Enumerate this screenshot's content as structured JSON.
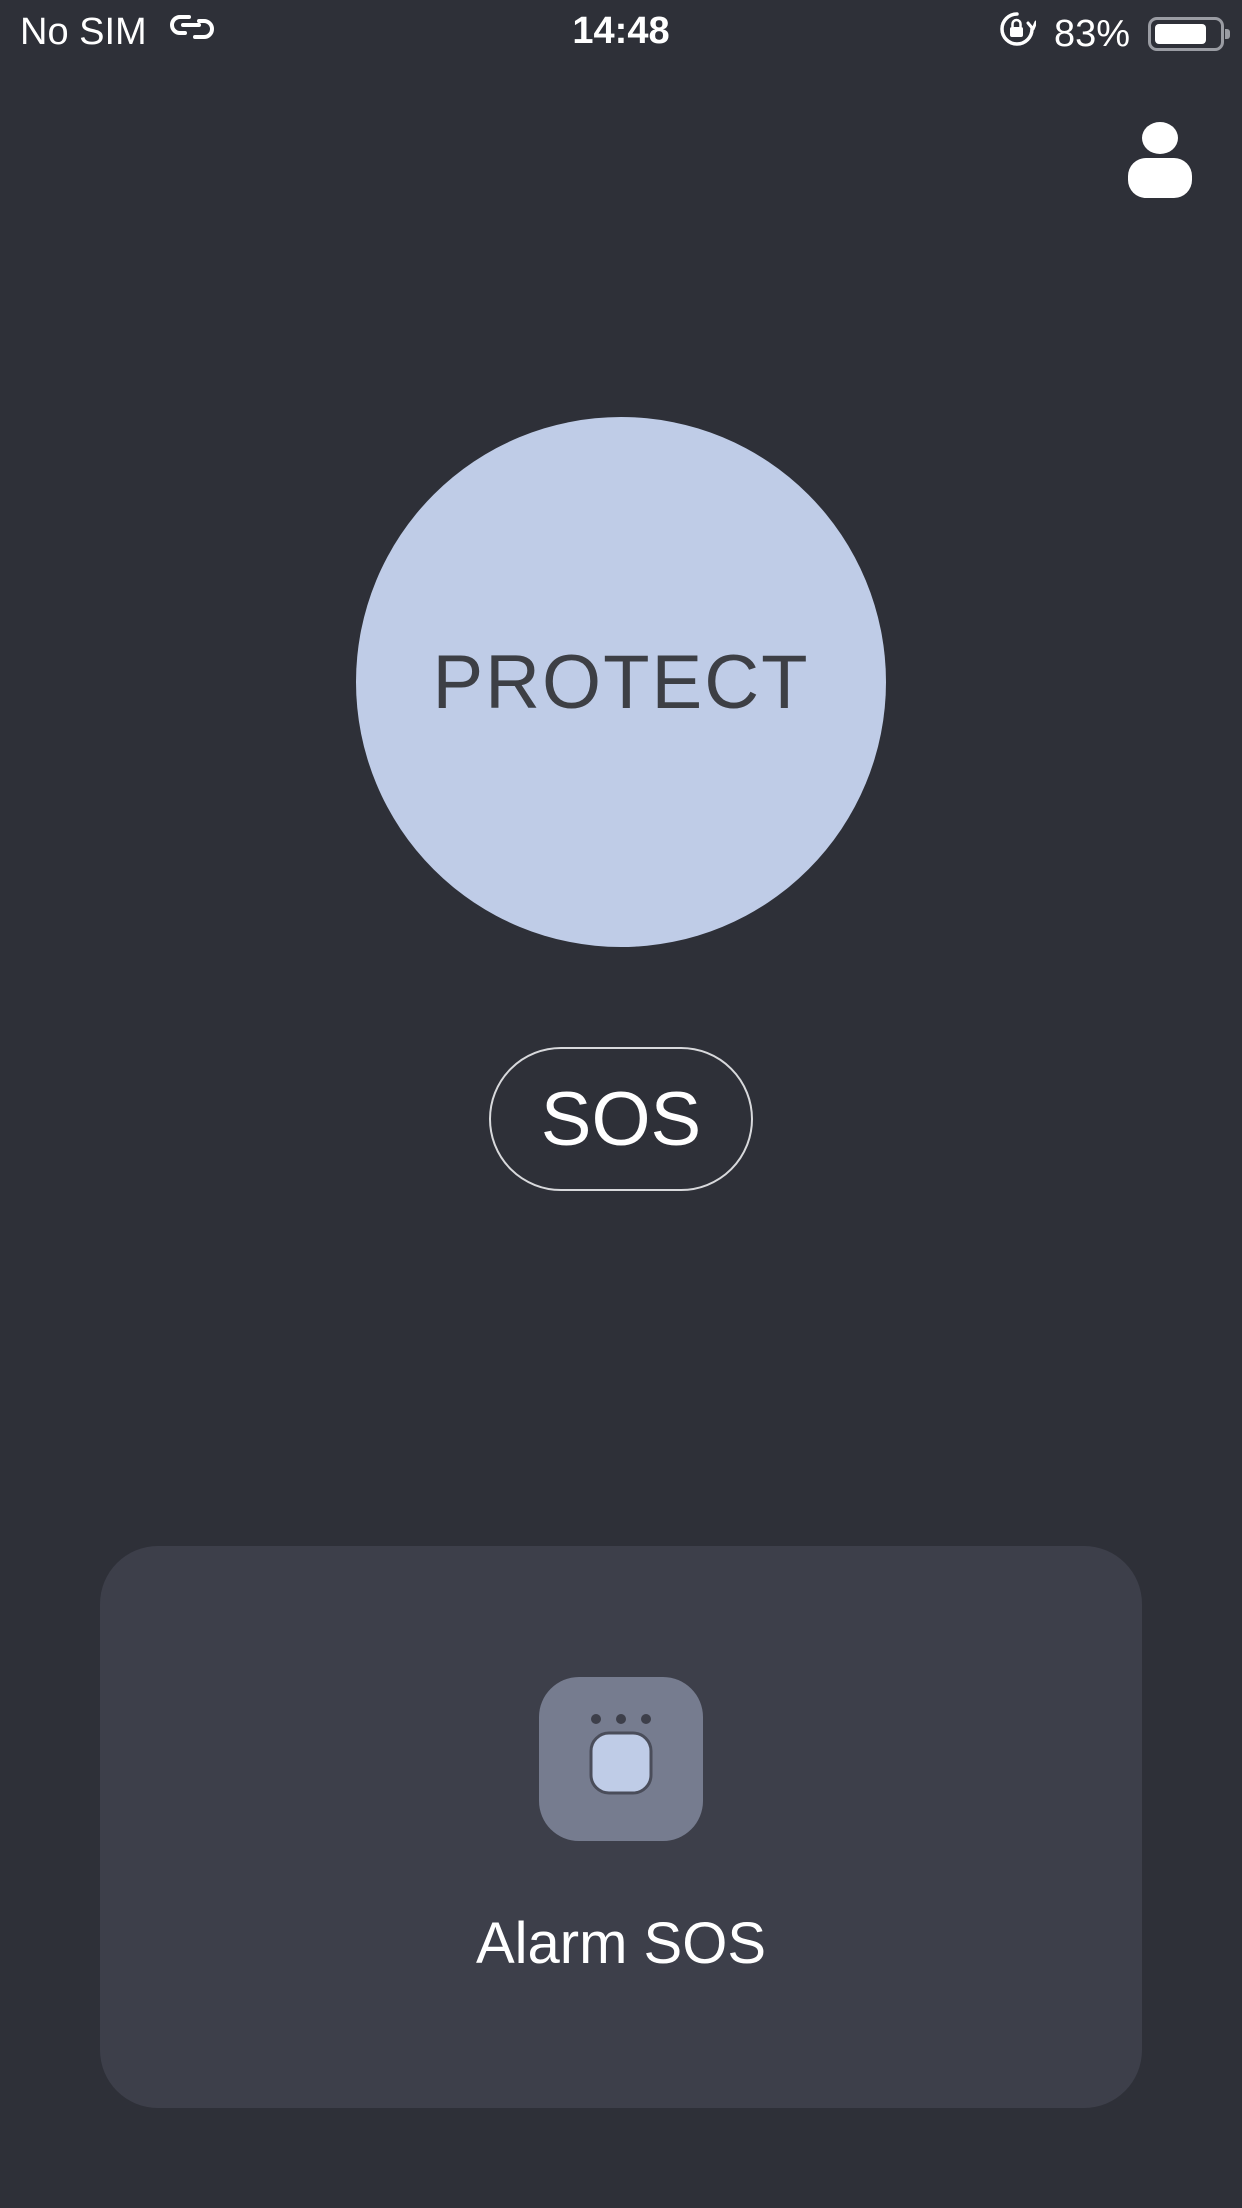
{
  "status_bar": {
    "carrier": "No SIM",
    "wifi_icon": "link-icon",
    "time": "14:48",
    "rotation_lock_icon": "rotation-lock-icon",
    "battery_percent": "83%",
    "battery_level": 0.83
  },
  "header": {
    "profile_icon": "person-icon"
  },
  "main": {
    "protect_label": "PROTECT",
    "protect_color": "#bfcce7",
    "sos_label": "SOS"
  },
  "alarm_card": {
    "icon": "alarm-device-icon",
    "label": "Alarm SOS"
  },
  "colors": {
    "background": "#2e3038",
    "card": "#3d3f4a",
    "accent": "#bfcce7"
  }
}
